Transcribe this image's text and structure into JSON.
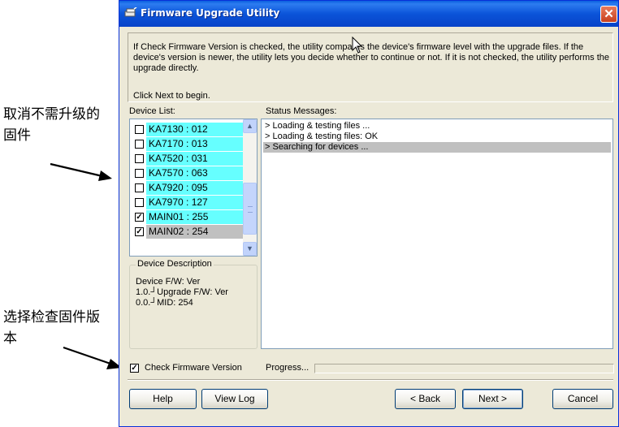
{
  "annotations": {
    "deselect": "取消不需升级的固件",
    "check_version": "选择检查固件版本"
  },
  "window": {
    "title": "Firmware Upgrade Utility",
    "close_symbol": "✕"
  },
  "info": {
    "text": "If Check Firmware Version is checked, the utility compares the device's firmware level with the upgrade files. If the device's version is newer, the utility lets you decide whether to continue or not. If it is not checked, the utility performs the upgrade directly.",
    "next_hint": "Click Next to begin."
  },
  "device_list": {
    "label": "Device List:",
    "items": [
      {
        "label": "KA7130 : 012",
        "checked": false,
        "selected": false
      },
      {
        "label": "KA7170 : 013",
        "checked": false,
        "selected": false
      },
      {
        "label": "KA7520 : 031",
        "checked": false,
        "selected": false
      },
      {
        "label": "KA7570 : 063",
        "checked": false,
        "selected": false
      },
      {
        "label": "KA7920 : 095",
        "checked": false,
        "selected": false
      },
      {
        "label": "KA7970 : 127",
        "checked": false,
        "selected": false
      },
      {
        "label": "MAIN01 : 255",
        "checked": true,
        "selected": false
      },
      {
        "label": "MAIN02 : 254",
        "checked": true,
        "selected": true
      }
    ],
    "scroll_up": "▲",
    "scroll_down": "▼"
  },
  "device_description": {
    "legend": "Device Description",
    "text": "Device F/W: Ver 1.0.┘Upgrade F/W: Ver 0.0.┘MID: 254"
  },
  "status": {
    "label": "Status Messages:",
    "lines": [
      {
        "text": "> Loading & testing files ...",
        "selected": false
      },
      {
        "text": "> Loading & testing files: OK",
        "selected": false
      },
      {
        "text": "> Searching for devices ...",
        "selected": true
      }
    ]
  },
  "check_firmware": {
    "label": "Check Firmware Version",
    "checked": true,
    "check_mark": "✓"
  },
  "progress": {
    "label": "Progress...",
    "value": 0
  },
  "buttons": {
    "help": "Help",
    "view_log": "View Log",
    "back": "< Back",
    "next": "Next >",
    "cancel": "Cancel"
  },
  "colors": {
    "title_bar": "#0b54d9",
    "device_highlight": "#66ffff",
    "selection_gray": "#c0c0c0",
    "dialog_bg": "#ece9d8"
  }
}
